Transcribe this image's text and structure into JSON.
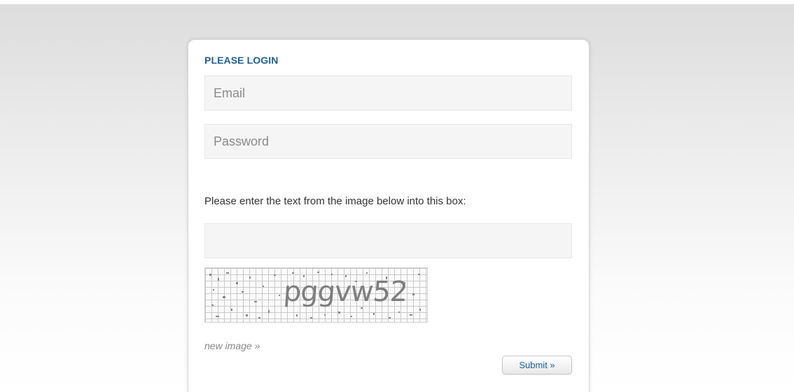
{
  "login": {
    "title": "PLEASE LOGIN",
    "email_placeholder": "Email",
    "password_placeholder": "Password",
    "captcha_instructions": "Please enter the text from the image below into this box:",
    "captcha_value": "",
    "captcha_image_text": "pggvw52",
    "new_image_label": "new image »",
    "submit_label": "Submit »"
  },
  "colors": {
    "title": "#20609a",
    "field_background": "#f5f5f5",
    "link": "#888888"
  }
}
